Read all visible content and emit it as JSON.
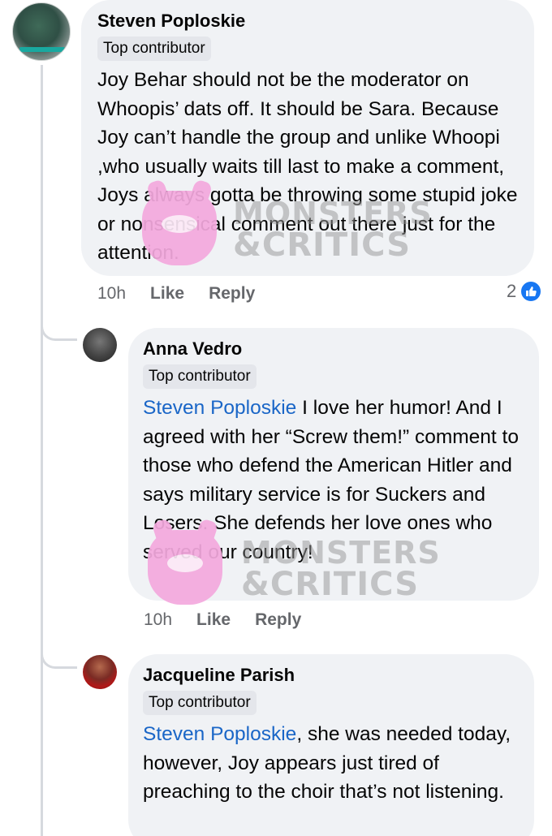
{
  "thread": {
    "main_comment": {
      "author": "Steven Poploskie",
      "badge": "Top contributor",
      "text": "Joy Behar should not be the moderator on Whoopis’ dats off. It should be Sara. Because Joy can’t handle the group and unlike Whoopi ,who usually waits till last to make a comment, Joys always gotta be throwing some stupid joke or nonsensical comment out there just for the attention.",
      "time": "10h",
      "like_label": "Like",
      "reply_label": "Reply",
      "reaction_count": "2",
      "reaction_icon": "like-thumb-icon"
    },
    "replies": [
      {
        "author": "Anna Vedro",
        "badge": "Top contributor",
        "mention": "Steven Poploskie",
        "text": " I love her humor! And I agreed with her “Screw them!” comment to those who defend the American Hitler and says military service is for Suckers and Losers. She defends her love ones who served our country!",
        "time": "10h",
        "like_label": "Like",
        "reply_label": "Reply"
      },
      {
        "author": "Jacqueline Parish",
        "badge": "Top contributor",
        "mention": "Steven Poploskie",
        "text": ", she was needed today, however, Joy appears just tired of preaching to the choir that’s not listening."
      }
    ]
  },
  "watermark": {
    "line1": "MONSTERS",
    "line2": "&CRITICS",
    "mascot_color": "#f4a9de"
  },
  "colors": {
    "bubble": "#f0f2f5",
    "mention": "#1a66c7",
    "meta": "#65676b",
    "like_blue": "#1877f2"
  }
}
